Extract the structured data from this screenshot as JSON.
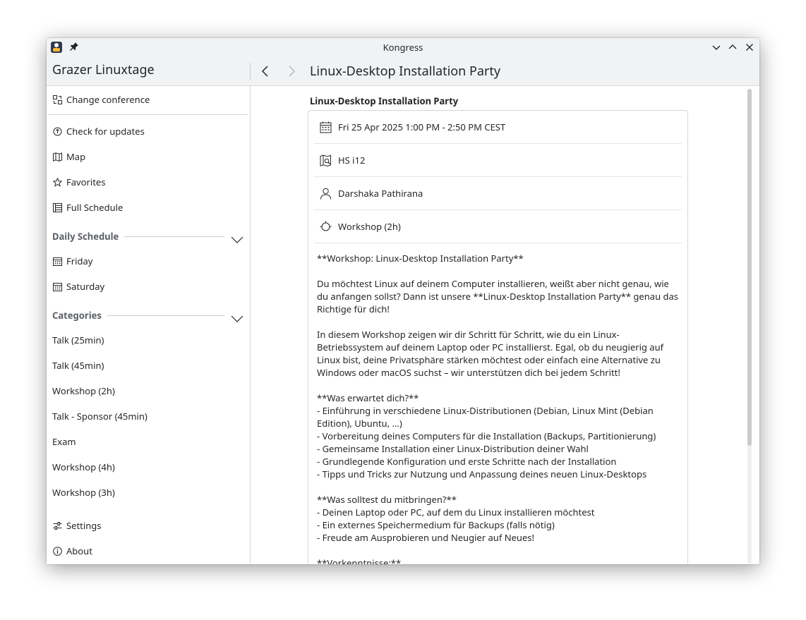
{
  "window": {
    "title": "Kongress"
  },
  "header": {
    "brand": "Grazer Linuxtage",
    "page_title": "Linux-Desktop Installation Party"
  },
  "sidebar": {
    "change_conference": "Change conference",
    "items": [
      {
        "label": "Check for updates",
        "icon": "update-icon"
      },
      {
        "label": "Map",
        "icon": "map-icon"
      },
      {
        "label": "Favorites",
        "icon": "star-icon"
      },
      {
        "label": "Full Schedule",
        "icon": "schedule-icon"
      }
    ],
    "daily_schedule": {
      "heading": "Daily Schedule",
      "days": [
        "Friday",
        "Saturday"
      ]
    },
    "categories": {
      "heading": "Categories",
      "items": [
        "Talk (25min)",
        "Talk (45min)",
        "Workshop (2h)",
        "Talk - Sponsor (45min)",
        "Exam",
        "Workshop (4h)",
        "Workshop (3h)"
      ]
    },
    "settings": "Settings",
    "about": "About"
  },
  "event": {
    "title": "Linux-Desktop Installation Party",
    "datetime": "Fri 25 Apr 2025 1:00 PM - 2:50 PM CEST",
    "room": "HS i12",
    "speaker": "Darshaka Pathirana",
    "category": "Workshop (2h)",
    "description": [
      "**Workshop: Linux-Desktop Installation Party**",
      "Du möchtest Linux auf deinem Computer installieren, weißt aber nicht genau, wie du anfangen sollst? Dann ist unsere **Linux-Desktop Installation Party** genau das Richtige für dich!",
      "In diesem Workshop zeigen wir dir Schritt für Schritt, wie du ein Linux-Betriebssystem auf deinem Laptop oder PC installierst. Egal, ob du neugierig auf Linux bist, deine Privatsphäre stärken möchtest oder einfach eine Alternative zu Windows oder macOS suchst – wir unterstützen dich bei jedem Schritt!",
      "**Was erwartet dich?**\n- Einführung in verschiedene Linux-Distributionen (Debian, Linux Mint (Debian Edition), Ubuntu, ...)\n- Vorbereitung deines Computers für die Installation (Backups, Partitionierung)\n- Gemeinsame Installation einer Linux-Distribution deiner Wahl\n- Grundlegende Konfiguration und erste Schritte nach der Installation\n- Tipps und Tricks zur Nutzung und Anpassung deines neuen Linux-Desktops",
      "**Was solltest du mitbringen?**\n- Deinen Laptop oder PC, auf dem du Linux installieren möchtest\n- Ein externes Speichermedium für Backups (falls nötig)\n- Freude am Ausprobieren und Neugier auf Neues!",
      "**Vorkenntnisse:**"
    ]
  }
}
